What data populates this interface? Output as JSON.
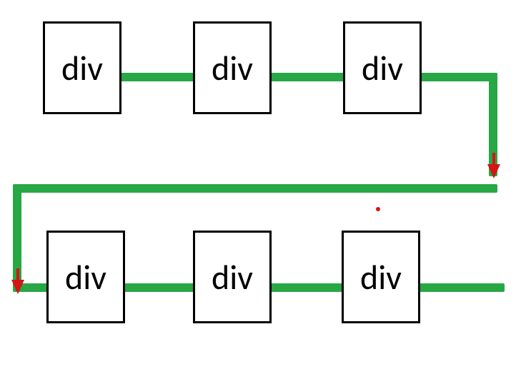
{
  "boxes": {
    "b1": "div",
    "b2": "div",
    "b3": "div",
    "b4": "div",
    "b5": "div",
    "b6": "div"
  },
  "flow": {
    "color": "#28a745",
    "arrow_color": "#d41515"
  }
}
